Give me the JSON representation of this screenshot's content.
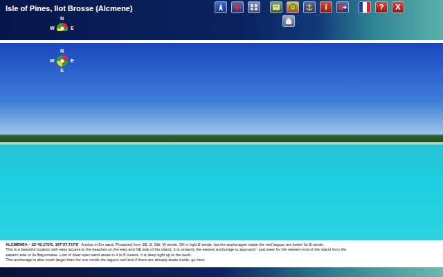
{
  "window": {
    "title": "Isle of Pines, Ilot Brosse (Alcmene)"
  },
  "header_compass": {
    "labels": [
      "N",
      "W",
      "E"
    ]
  },
  "photo_compass": {
    "labels": [
      "N",
      "W",
      "E",
      "S"
    ]
  },
  "toolbar": {
    "top": [
      [
        {
          "kind": "north",
          "label": ""
        },
        {
          "kind": "back",
          "label": ""
        },
        {
          "kind": "photos",
          "label": ""
        }
      ],
      [
        {
          "kind": "map",
          "label": ""
        },
        {
          "kind": "target",
          "label": ""
        },
        {
          "kind": "anchor",
          "label": ""
        },
        {
          "kind": "info",
          "label": "i"
        },
        {
          "kind": "exit",
          "label": ""
        }
      ],
      [
        {
          "kind": "flag",
          "label": ""
        },
        {
          "kind": "help",
          "label": "?"
        },
        {
          "kind": "close",
          "label": "X"
        }
      ]
    ],
    "bottom": [
      {
        "kind": "shell",
        "label": ""
      }
    ]
  },
  "caption": {
    "heading": "ALCMENEA – 22°42.170'S, 167°27.717'E",
    "lines": [
      "Anchor in 5m sand. Protected from SE, S, SW, W winds. OK in light E winds, but the anchorages inside the reef lagoon are better for E winds.",
      "This is a beautiful location with easy access to the beaches on the east and NE side of the island. It is certainly the easiest anchorage to approach - just steer for the western end of the island from the",
      "eastern side of Ile Bayonnaise. Lots of clear open sand areas in  4 to 5 meters. It is deep right up to the reefs.",
      "This anchorage is also much larger than the one inside the lagoon reef and if there are already boats inside, go here."
    ]
  }
}
